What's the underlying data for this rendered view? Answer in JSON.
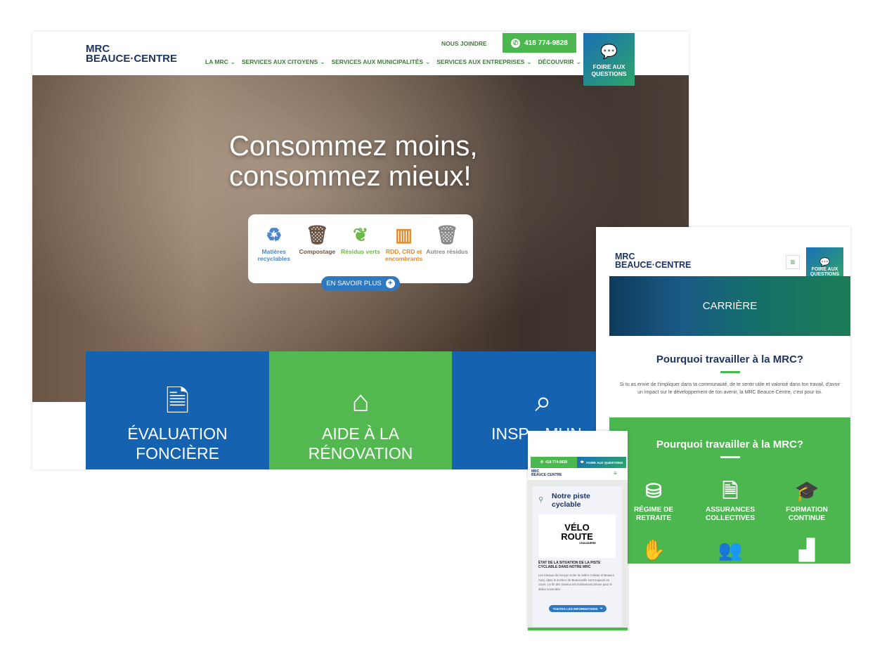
{
  "desktop": {
    "logo": {
      "line1": "MRC",
      "line2": "BEAUCE·CENTRE"
    },
    "nous_joindre": "NOUS JOINDRE",
    "phone": "418 774-9828",
    "nav": [
      "LA MRC",
      "SERVICES AUX CITOYENS",
      "SERVICES AUX MUNICIPALITÉS",
      "SERVICES AUX ENTREPRISES",
      "DÉCOUVRIR"
    ],
    "faq": "FOIRE AUX QUESTIONS",
    "hero_title_1": "Consommez moins,",
    "hero_title_2": "consommez mieux!",
    "categories": [
      {
        "label": "Matières recyclables",
        "icon": "recycle-icon",
        "color": "#4a86c8"
      },
      {
        "label": "Compostage",
        "icon": "compost-bin-icon",
        "color": "#6b5444"
      },
      {
        "label": "Résidus verts",
        "icon": "leaf-recycle-icon",
        "color": "#6cb94a"
      },
      {
        "label": "RDD, CRD et encombrants",
        "icon": "dumpster-icon",
        "color": "#e08a2c"
      },
      {
        "label": "Autres résidus",
        "icon": "trash-icon",
        "color": "#8a8a8a"
      }
    ],
    "more_button": "EN SAVOIR PLUS",
    "tiles": [
      {
        "label": "ÉVALUATION FONCIÈRE",
        "icon": "document-search-icon",
        "color": "#1563b0"
      },
      {
        "label": "AIDE À LA RÉNOVATION",
        "icon": "house-tools-icon",
        "color": "#52b84f"
      },
      {
        "label": "INSP... MUN...",
        "icon": "house-magnifier-icon",
        "color": "#1563b0"
      }
    ]
  },
  "tablet": {
    "logo": {
      "line1": "MRC",
      "line2": "BEAUCE·CENTRE"
    },
    "faq": "FOIRE AUX QUESTIONS",
    "banner": "CARRIÈRE",
    "heading": "Pourquoi travailler à la MRC?",
    "paragraph": "Si tu as envie de t'impliquer dans ta communauté, de te sentir utile et valorisé dans ton travail, d'avoir un impact sur le développement de ton avenir, la MRC Beauce-Centre, c'est pour toi.",
    "green_heading": "Pourquoi travailler à la MRC?",
    "benefits": [
      {
        "label": "RÉGIME DE RETRAITE",
        "icon": "coins-icon"
      },
      {
        "label": "ASSURANCES COLLECTIVES",
        "icon": "insurance-icon"
      },
      {
        "label": "FORMATION CONTINUE",
        "icon": "graduation-icon"
      }
    ]
  },
  "phone": {
    "phone": "418 774-9828",
    "faq": "FOIRE AUX QUESTIONS",
    "logo": {
      "line1": "MRC",
      "line2": "BEAUCE·CENTRE"
    },
    "card_title": "Notre piste cyclable",
    "brand_line1": "VÉLO",
    "brand_line2": "ROUTE",
    "brand_sub": "CHAUDIÈRE",
    "article_title": "ÉTAT DE LA SITUATION DE LA PISTE CYCLABLE DANS NOTRE MRC",
    "article_text": "Les travaux du tronçon entre la rivière Calway et Beauce Auto, dans le secteur de Beauceville sont toujours en cours. La fin des travaux est maintenant prévue pour le début novembre.",
    "button": "TOUTES LES INFORMATIONS"
  }
}
